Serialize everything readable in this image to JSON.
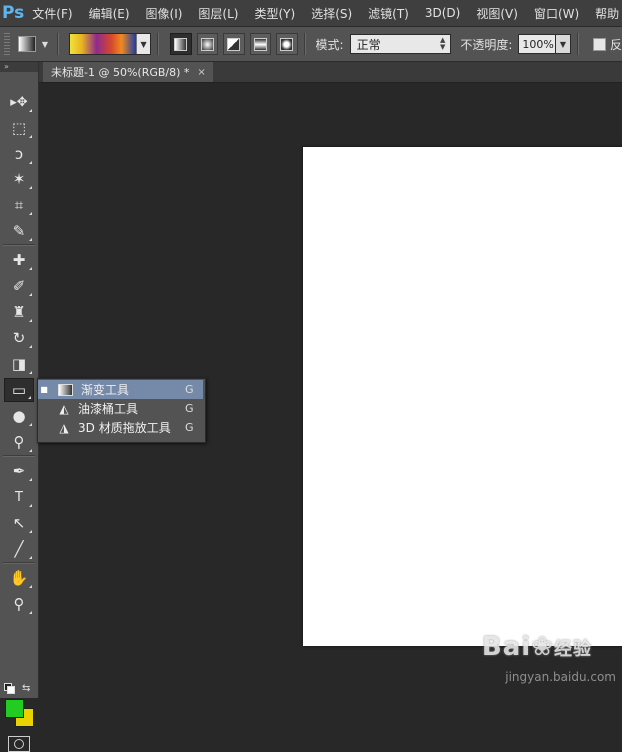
{
  "app": {
    "logo": "Ps"
  },
  "menu": [
    "文件(F)",
    "编辑(E)",
    "图像(I)",
    "图层(L)",
    "类型(Y)",
    "选择(S)",
    "滤镜(T)",
    "3D(D)",
    "视图(V)",
    "窗口(W)",
    "帮助"
  ],
  "options": {
    "mode_label": "模式:",
    "mode_value": "正常",
    "opacity_label": "不透明度:",
    "opacity_value": "100%",
    "reverse_label": "反"
  },
  "document_tab": {
    "title": "未标题-1 @ 50%(RGB/8) *",
    "close": "×"
  },
  "tools": [
    {
      "name": "move",
      "icon": "▸✥"
    },
    {
      "name": "marquee",
      "icon": "⬚"
    },
    {
      "name": "lasso",
      "icon": "ↄ"
    },
    {
      "name": "magic-wand",
      "icon": "✶"
    },
    {
      "name": "crop",
      "icon": "⌗"
    },
    {
      "name": "eyedropper",
      "icon": "✎"
    },
    {
      "name": "healing",
      "icon": "✚"
    },
    {
      "name": "brush",
      "icon": "✐"
    },
    {
      "name": "stamp",
      "icon": "♜"
    },
    {
      "name": "history-brush",
      "icon": "↻"
    },
    {
      "name": "eraser",
      "icon": "◨"
    },
    {
      "name": "gradient",
      "icon": "▭"
    },
    {
      "name": "blur",
      "icon": "●"
    },
    {
      "name": "dodge",
      "icon": "⚲"
    },
    {
      "name": "pen",
      "icon": "✒"
    },
    {
      "name": "type",
      "icon": "T"
    },
    {
      "name": "path-selection",
      "icon": "↖"
    },
    {
      "name": "line",
      "icon": "╱"
    },
    {
      "name": "hand",
      "icon": "✋"
    },
    {
      "name": "zoom",
      "icon": "⚲"
    }
  ],
  "flyout": [
    {
      "label": "渐变工具",
      "shortcut": "G",
      "selected": true
    },
    {
      "label": "油漆桶工具",
      "shortcut": "G",
      "selected": false
    },
    {
      "label": "3D 材质拖放工具",
      "shortcut": "G",
      "selected": false
    }
  ],
  "colors": {
    "foreground": "#22cc22",
    "background": "#ecd100",
    "accent": "#7589a9"
  },
  "watermark": {
    "brand_a": "Bai",
    "brand_b": "经验",
    "url": "jingyan.baidu.com"
  }
}
